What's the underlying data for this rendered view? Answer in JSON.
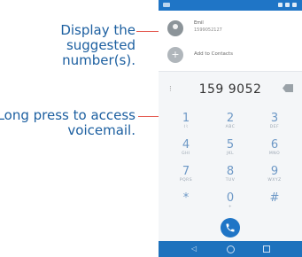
{
  "callouts": {
    "suggested_text": "Display the suggested number(s).",
    "voicemail_text": "Long press to access voicemail."
  },
  "colors": {
    "callout_text": "#1c5fa0",
    "leader_line": "#e4574e",
    "status_bar": "#1f75c6",
    "nav_bar": "#1e72bd",
    "key_digit": "#6d98c6"
  },
  "dialer": {
    "suggestions": [
      {
        "name": "Emil",
        "number": "1599052127",
        "icon": "person-avatar-icon"
      },
      {
        "label": "Add to Contacts",
        "icon": "add-contact-icon"
      }
    ],
    "dialed_number": "159 9052",
    "keys": [
      {
        "digit": "1",
        "sub": ""
      },
      {
        "digit": "2",
        "sub": "ABC"
      },
      {
        "digit": "3",
        "sub": "DEF"
      },
      {
        "digit": "4",
        "sub": "GHI"
      },
      {
        "digit": "5",
        "sub": "JKL"
      },
      {
        "digit": "6",
        "sub": "MNO"
      },
      {
        "digit": "7",
        "sub": "PQRS"
      },
      {
        "digit": "8",
        "sub": "TUV"
      },
      {
        "digit": "9",
        "sub": "WXYZ"
      },
      {
        "digit": "*",
        "sub": ""
      },
      {
        "digit": "0",
        "sub": "+"
      },
      {
        "digit": "#",
        "sub": ""
      }
    ]
  }
}
